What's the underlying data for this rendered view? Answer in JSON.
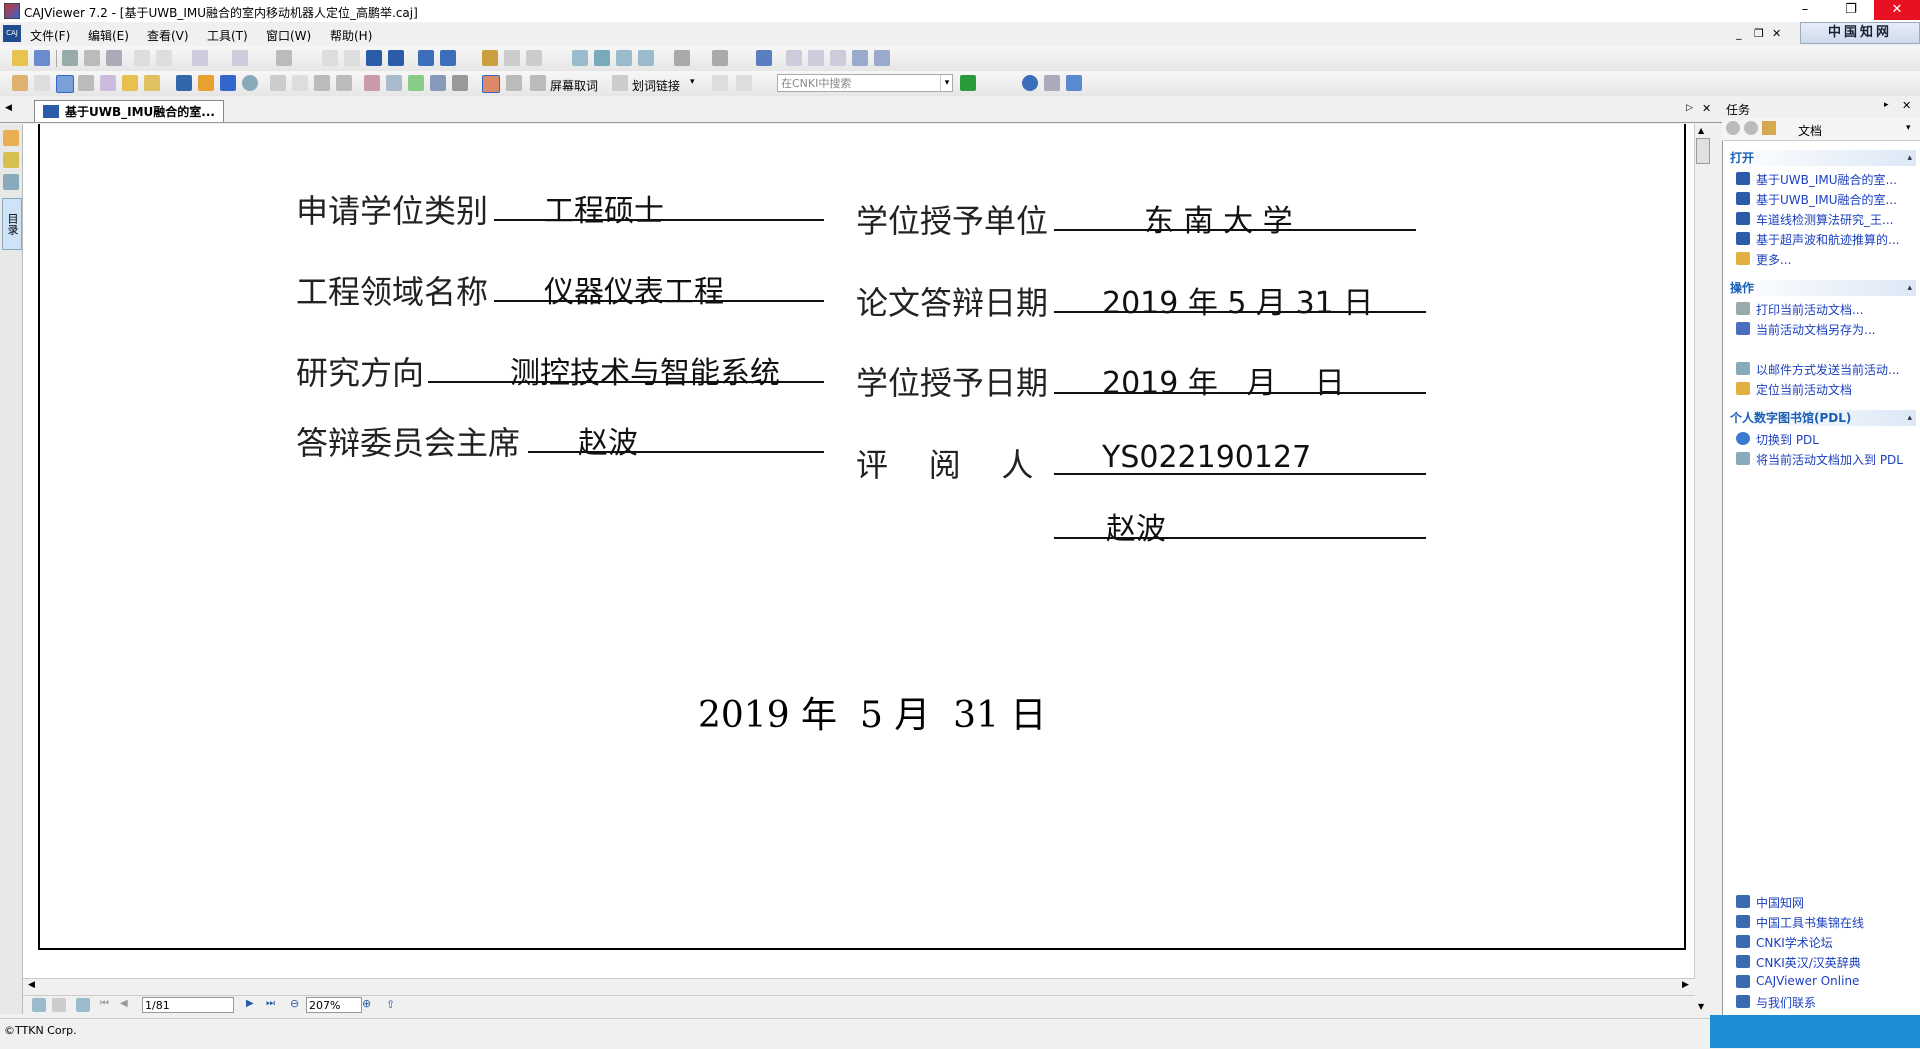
{
  "window": {
    "title": "CAJViewer 7.2 - [基于UWB_IMU融合的室内移动机器人定位_高鹏举.caj]",
    "minimize": "–",
    "restore": "❐",
    "close": "✕"
  },
  "menu": {
    "items": [
      "文件(F)",
      "编辑(E)",
      "查看(V)",
      "工具(T)",
      "窗口(W)",
      "帮助(H)"
    ],
    "mdi_min": "_",
    "mdi_restore": "❐",
    "mdi_close": "✕",
    "brand": "中国知网"
  },
  "toolbar2": {
    "screen_wordfetch": "屏幕取词",
    "word_link": "划词链接",
    "search_placeholder": "在CNKI中搜索"
  },
  "tab": {
    "label": "基于UWB_IMU融合的室..."
  },
  "sidebar": {
    "toc_label": "目录"
  },
  "document": {
    "left_fields": [
      {
        "label": "申请学位类别",
        "value": "工程硕士"
      },
      {
        "label": "工程领域名称",
        "value": "仪器仪表工程"
      },
      {
        "label": "研究方向",
        "value": "测控技术与智能系统"
      },
      {
        "label": "答辩委员会主席",
        "value": "赵波"
      }
    ],
    "right_fields": [
      {
        "label": "学位授予单位",
        "value": "东 南 大 学"
      },
      {
        "label": "论文答辩日期",
        "value": "2019 年 5 月 31 日"
      },
      {
        "label": "学位授予日期",
        "value": "2019 年   月    日"
      },
      {
        "label": "评    阅    人",
        "value": "YS022190127"
      },
      {
        "label": "",
        "value": "赵波"
      }
    ],
    "bottom_date": "2019 年  5 月  31 日"
  },
  "nav": {
    "page": "1/81",
    "zoom": "207%"
  },
  "status": {
    "text": "©TTKN Corp."
  },
  "taskpane": {
    "title": "任务",
    "doc_label": "文档",
    "sections": {
      "open": {
        "title": "打开",
        "items": [
          "基于UWB_IMU融合的室...",
          "基于UWB_IMU融合的室...",
          "车道线检测算法研究_王...",
          "基于超声波和航迹推算的...",
          "更多..."
        ]
      },
      "actions": {
        "title": "操作",
        "items": [
          "打印当前活动文档...",
          "当前活动文档另存为...",
          "以邮件方式发送当前活动...",
          "定位当前活动文档"
        ]
      },
      "pdl": {
        "title": "个人数字图书馆(PDL)",
        "items": [
          "切换到 PDL",
          "将当前活动文档加入到 PDL"
        ]
      }
    },
    "links": [
      "中国知网",
      "中国工具书集锦在线",
      "CNKI学术论坛",
      "CNKI英汉/汉英辞典",
      "CAJViewer Online",
      "与我们联系"
    ]
  },
  "colors": {
    "link_blue": "#1b3fbf",
    "section_blue": "#1b5fb4",
    "close_red": "#e81123"
  }
}
